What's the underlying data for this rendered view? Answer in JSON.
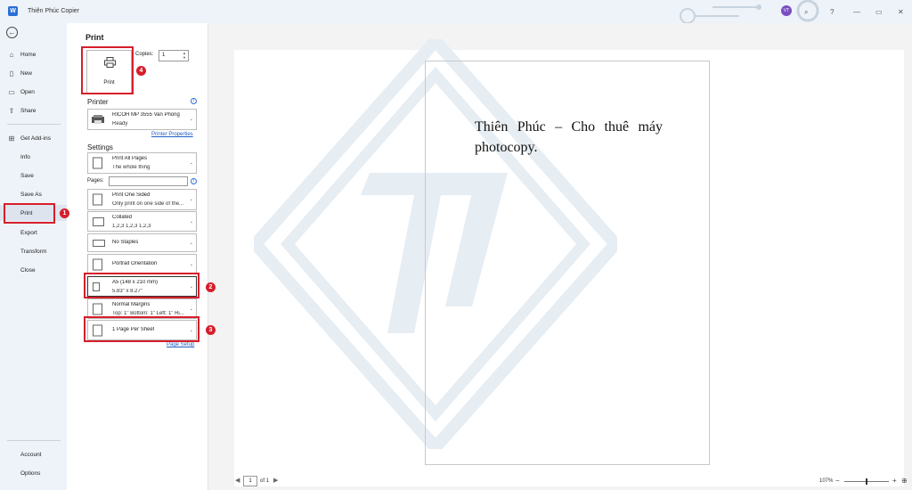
{
  "titlebar": {
    "app_icon": "word-icon",
    "title": "Thiên Phúc Copier",
    "avatar_initials": "VT",
    "help": "?",
    "minimize": "—",
    "maximize": "▭",
    "close": "✕"
  },
  "nav": {
    "back_icon": "back-arrow-icon",
    "items": [
      {
        "label": "Home",
        "icon": "home-icon"
      },
      {
        "label": "New",
        "icon": "new-document-icon"
      },
      {
        "label": "Open",
        "icon": "folder-open-icon"
      },
      {
        "label": "Share",
        "icon": "share-icon"
      },
      {
        "label": "Get Add-ins",
        "icon": "add-ins-icon"
      },
      {
        "label": "Info"
      },
      {
        "label": "Save"
      },
      {
        "label": "Save As"
      },
      {
        "label": "Print"
      },
      {
        "label": "Export"
      },
      {
        "label": "Transform"
      },
      {
        "label": "Close"
      }
    ],
    "bottom_items": [
      {
        "label": "Account"
      },
      {
        "label": "Options"
      }
    ],
    "active": "Print"
  },
  "print_panel": {
    "title": "Print",
    "print_button_label": "Print",
    "copies_label": "Copies:",
    "copies_value": "1",
    "printer_heading": "Printer",
    "printer_name": "RICOH MP 3555 Van Phong",
    "printer_status": "Ready",
    "printer_properties_link": "Printer Properties",
    "settings_heading": "Settings",
    "pages_label": "Pages:",
    "pages_value": "",
    "settings": [
      {
        "line1": "Print All Pages",
        "line2": "The whole thing",
        "icon": "pages-icon"
      },
      {
        "line1": "Print One Sided",
        "line2": "Only print on one side of the...",
        "icon": "one-sided-icon"
      },
      {
        "line1": "Collated",
        "line2": "1,2,3    1,2,3    1,2,3",
        "icon": "collated-icon"
      },
      {
        "line1": "No Staples",
        "line2": "",
        "icon": "staple-icon"
      },
      {
        "line1": "Portrait Orientation",
        "line2": "",
        "icon": "portrait-icon"
      },
      {
        "line1": "A5 (148 x 210 mm)",
        "line2": "5.83\" x 8.27\"",
        "icon": "paper-size-icon"
      },
      {
        "line1": "Normal Margins",
        "line2": "Top: 1\" Bottom: 1\" Left: 1\" Ri...",
        "icon": "margins-icon"
      },
      {
        "line1": "1 Page Per Sheet",
        "line2": "",
        "icon": "pages-per-sheet-icon"
      }
    ],
    "page_setup_link": "Page Setup"
  },
  "annotations": [
    "1",
    "2",
    "3",
    "4"
  ],
  "preview": {
    "page_text": "Thiên Phúc – Cho thuê máy photocopy.",
    "current_page": "1",
    "of_pages": "of 1",
    "zoom": "107%",
    "zoom_minus": "−",
    "zoom_plus": "+"
  },
  "colors": {
    "accent_red": "#d61e2b",
    "link_blue": "#1f5ec4",
    "nav_bg": "#eef3f9"
  }
}
